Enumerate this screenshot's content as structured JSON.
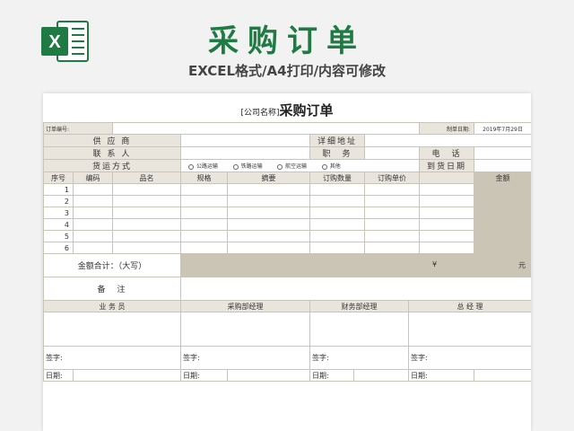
{
  "banner": {
    "logo_letter": "X",
    "title": "采购订单",
    "subtitle": "EXCEL格式/A4打印/内容可修改"
  },
  "form": {
    "company_placeholder": "[公司名称]",
    "title": "采购订单",
    "order_no_label": "订单编号:",
    "order_date_label": "制单日期:",
    "order_date_value": "2019年7月29日",
    "supplier_label": "供 应 商",
    "address_label": "详细地址",
    "contact_label": "联 系 人",
    "position_label": "职　务",
    "phone_label": "电　话",
    "shipping_label": "货运方式",
    "shipping_options": [
      "公路运输",
      "铁路运输",
      "航空运输",
      "其他"
    ],
    "arrival_label": "到货日期",
    "columns": [
      "序号",
      "编码",
      "品名",
      "规格",
      "摘要",
      "订购数量",
      "订购单价",
      "金额"
    ],
    "rows": [
      "1",
      "2",
      "3",
      "4",
      "5",
      "6"
    ],
    "total_label": "金额合计：（大写）",
    "yen_symbol": "¥",
    "yuan_label": "元",
    "remarks_label": "备　注",
    "signers": [
      "业 务 员",
      "采购部经理",
      "财务部经理",
      "总 经 理"
    ],
    "sign_label": "签字:",
    "date_label": "日期:"
  }
}
